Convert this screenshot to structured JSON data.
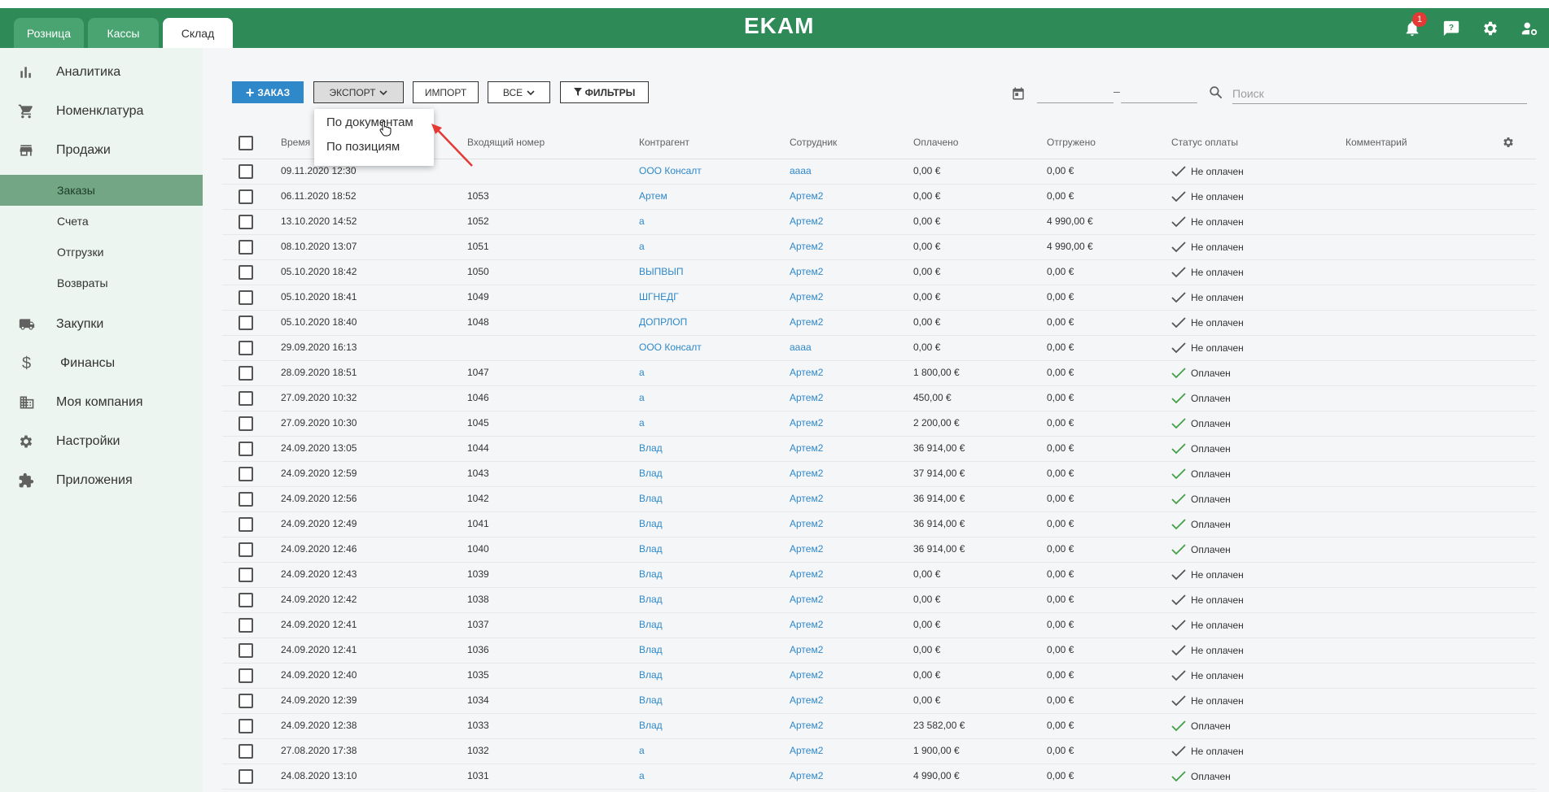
{
  "app": {
    "logo": "EKAM",
    "tabs": [
      {
        "label": "Розница",
        "active": false
      },
      {
        "label": "Кассы",
        "active": false
      },
      {
        "label": "Склад",
        "active": true
      }
    ],
    "notification_count": "1",
    "accent_color": "#2e8b57"
  },
  "sidebar": {
    "items": [
      {
        "label": "Аналитика",
        "icon": "bar-chart-icon"
      },
      {
        "label": "Номенклатура",
        "icon": "cart-icon"
      },
      {
        "label": "Продажи",
        "icon": "store-icon"
      },
      {
        "label": "Закупки",
        "icon": "truck-icon"
      },
      {
        "label": "Финансы",
        "icon": "dollar-icon"
      },
      {
        "label": "Моя компания",
        "icon": "building-icon"
      },
      {
        "label": "Настройки",
        "icon": "gear-icon"
      },
      {
        "label": "Приложения",
        "icon": "puzzle-icon"
      }
    ],
    "sales_subitems": [
      {
        "label": "Заказы",
        "active": true
      },
      {
        "label": "Счета",
        "active": false
      },
      {
        "label": "Отгрузки",
        "active": false
      },
      {
        "label": "Возвраты",
        "active": false
      }
    ]
  },
  "toolbar": {
    "order_label": "ЗАКАЗ",
    "export_label": "ЭКСПОРТ",
    "import_label": "ИМПОРТ",
    "all_label": "ВСЕ",
    "filters_label": "ФИЛЬТРЫ",
    "date_separator": "–",
    "search_placeholder": "Поиск"
  },
  "export_menu": {
    "items": [
      "По документам",
      "По позициям"
    ]
  },
  "table": {
    "headers": {
      "time": "Время",
      "incoming": "Входящий номер",
      "counterparty": "Контрагент",
      "employee": "Сотрудник",
      "paid": "Оплачено",
      "shipped": "Отгружено",
      "pay_status": "Статус оплаты",
      "comment": "Комментарий"
    },
    "rows": [
      {
        "time": "09.11.2020 12:30",
        "num": "",
        "counterparty": "ООО Консалт",
        "employee": "аааа",
        "paid": "0,00 €",
        "shipped": "0,00 €",
        "status": "Не оплачен",
        "is_paid": false
      },
      {
        "time": "06.11.2020 18:52",
        "num": "1053",
        "counterparty": "Артем",
        "employee": "Артем2",
        "paid": "0,00 €",
        "shipped": "0,00 €",
        "status": "Не оплачен",
        "is_paid": false
      },
      {
        "time": "13.10.2020 14:52",
        "num": "1052",
        "counterparty": "а",
        "employee": "Артем2",
        "paid": "0,00 €",
        "shipped": "4 990,00 €",
        "status": "Не оплачен",
        "is_paid": false
      },
      {
        "time": "08.10.2020 13:07",
        "num": "1051",
        "counterparty": "а",
        "employee": "Артем2",
        "paid": "0,00 €",
        "shipped": "4 990,00 €",
        "status": "Не оплачен",
        "is_paid": false
      },
      {
        "time": "05.10.2020 18:42",
        "num": "1050",
        "counterparty": "ВЫПВЫП",
        "employee": "Артем2",
        "paid": "0,00 €",
        "shipped": "0,00 €",
        "status": "Не оплачен",
        "is_paid": false
      },
      {
        "time": "05.10.2020 18:41",
        "num": "1049",
        "counterparty": "ШГНЕДГ",
        "employee": "Артем2",
        "paid": "0,00 €",
        "shipped": "0,00 €",
        "status": "Не оплачен",
        "is_paid": false
      },
      {
        "time": "05.10.2020 18:40",
        "num": "1048",
        "counterparty": "ДОПРЛОП",
        "employee": "Артем2",
        "paid": "0,00 €",
        "shipped": "0,00 €",
        "status": "Не оплачен",
        "is_paid": false
      },
      {
        "time": "29.09.2020 16:13",
        "num": "",
        "counterparty": "ООО Консалт",
        "employee": "аааа",
        "paid": "0,00 €",
        "shipped": "0,00 €",
        "status": "Не оплачен",
        "is_paid": false
      },
      {
        "time": "28.09.2020 18:51",
        "num": "1047",
        "counterparty": "а",
        "employee": "Артем2",
        "paid": "1 800,00 €",
        "shipped": "0,00 €",
        "status": "Оплачен",
        "is_paid": true
      },
      {
        "time": "27.09.2020 10:32",
        "num": "1046",
        "counterparty": "а",
        "employee": "Артем2",
        "paid": "450,00 €",
        "shipped": "0,00 €",
        "status": "Оплачен",
        "is_paid": true
      },
      {
        "time": "27.09.2020 10:30",
        "num": "1045",
        "counterparty": "а",
        "employee": "Артем2",
        "paid": "2 200,00 €",
        "shipped": "0,00 €",
        "status": "Оплачен",
        "is_paid": true
      },
      {
        "time": "24.09.2020 13:05",
        "num": "1044",
        "counterparty": "Влад",
        "employee": "Артем2",
        "paid": "36 914,00 €",
        "shipped": "0,00 €",
        "status": "Оплачен",
        "is_paid": true
      },
      {
        "time": "24.09.2020 12:59",
        "num": "1043",
        "counterparty": "Влад",
        "employee": "Артем2",
        "paid": "37 914,00 €",
        "shipped": "0,00 €",
        "status": "Оплачен",
        "is_paid": true
      },
      {
        "time": "24.09.2020 12:56",
        "num": "1042",
        "counterparty": "Влад",
        "employee": "Артем2",
        "paid": "36 914,00 €",
        "shipped": "0,00 €",
        "status": "Оплачен",
        "is_paid": true
      },
      {
        "time": "24.09.2020 12:49",
        "num": "1041",
        "counterparty": "Влад",
        "employee": "Артем2",
        "paid": "36 914,00 €",
        "shipped": "0,00 €",
        "status": "Оплачен",
        "is_paid": true
      },
      {
        "time": "24.09.2020 12:46",
        "num": "1040",
        "counterparty": "Влад",
        "employee": "Артем2",
        "paid": "36 914,00 €",
        "shipped": "0,00 €",
        "status": "Оплачен",
        "is_paid": true
      },
      {
        "time": "24.09.2020 12:43",
        "num": "1039",
        "counterparty": "Влад",
        "employee": "Артем2",
        "paid": "0,00 €",
        "shipped": "0,00 €",
        "status": "Не оплачен",
        "is_paid": false
      },
      {
        "time": "24.09.2020 12:42",
        "num": "1038",
        "counterparty": "Влад",
        "employee": "Артем2",
        "paid": "0,00 €",
        "shipped": "0,00 €",
        "status": "Не оплачен",
        "is_paid": false
      },
      {
        "time": "24.09.2020 12:41",
        "num": "1037",
        "counterparty": "Влад",
        "employee": "Артем2",
        "paid": "0,00 €",
        "shipped": "0,00 €",
        "status": "Не оплачен",
        "is_paid": false
      },
      {
        "time": "24.09.2020 12:41",
        "num": "1036",
        "counterparty": "Влад",
        "employee": "Артем2",
        "paid": "0,00 €",
        "shipped": "0,00 €",
        "status": "Не оплачен",
        "is_paid": false
      },
      {
        "time": "24.09.2020 12:40",
        "num": "1035",
        "counterparty": "Влад",
        "employee": "Артем2",
        "paid": "0,00 €",
        "shipped": "0,00 €",
        "status": "Не оплачен",
        "is_paid": false
      },
      {
        "time": "24.09.2020 12:39",
        "num": "1034",
        "counterparty": "Влад",
        "employee": "Артем2",
        "paid": "0,00 €",
        "shipped": "0,00 €",
        "status": "Не оплачен",
        "is_paid": false
      },
      {
        "time": "24.09.2020 12:38",
        "num": "1033",
        "counterparty": "Влад",
        "employee": "Артем2",
        "paid": "23 582,00 €",
        "shipped": "0,00 €",
        "status": "Оплачен",
        "is_paid": true
      },
      {
        "time": "27.08.2020 17:38",
        "num": "1032",
        "counterparty": "а",
        "employee": "Артем2",
        "paid": "1 900,00 €",
        "shipped": "0,00 €",
        "status": "Не оплачен",
        "is_paid": false
      },
      {
        "time": "24.08.2020 13:10",
        "num": "1031",
        "counterparty": "а",
        "employee": "Артем2",
        "paid": "4 990,00 €",
        "shipped": "0,00 €",
        "status": "Оплачен",
        "is_paid": true
      }
    ]
  }
}
